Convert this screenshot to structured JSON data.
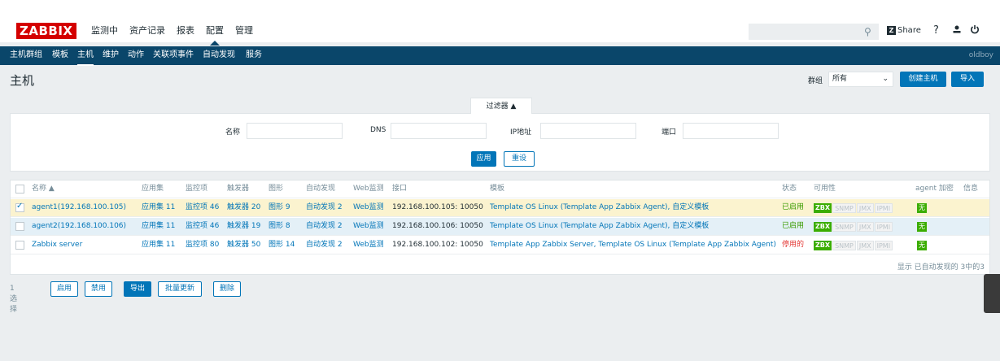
{
  "logo": "ZABBIX",
  "main_menu": [
    "监测中",
    "资产记录",
    "报表",
    "配置",
    "管理"
  ],
  "main_menu_selected": "配置",
  "share": "Share",
  "help": "?",
  "sub_menu": [
    "主机群组",
    "模板",
    "主机",
    "维护",
    "动作",
    "关联项事件",
    "自动发现",
    "服务"
  ],
  "sub_menu_selected": "主机",
  "user": "oldboy",
  "page_title": "主机",
  "group_filter": {
    "label": "群组",
    "value": "所有"
  },
  "create_button": "创建主机",
  "import_button": "导入",
  "filter": {
    "tab": "过滤器 ▲",
    "name_label": "名称",
    "dns_label": "DNS",
    "ip_label": "IP地址",
    "port_label": "端口",
    "apply": "应用",
    "reset": "重设"
  },
  "table": {
    "headers": [
      "名称 ▲",
      "应用集",
      "监控项",
      "触发器",
      "图形",
      "自动发现",
      "Web监测",
      "接口",
      "模板",
      "状态",
      "可用性",
      "agent 加密",
      "信息"
    ],
    "rows": [
      {
        "name": "agent1(192.168.100.105)",
        "apps": "应用集 11",
        "items": "监控项 46",
        "triggers": "触发器 20",
        "graphs": "图形 9",
        "discovery": "自动发现 2",
        "web": "Web监测",
        "interface": "192.168.100.105: 10050",
        "templates": "Template OS Linux (Template App Zabbix Agent), 自定义模板",
        "status": "已启用",
        "checked": true
      },
      {
        "name": "agent2(192.168.100.106)",
        "apps": "应用集 11",
        "items": "监控项 46",
        "triggers": "触发器 19",
        "graphs": "图形 8",
        "discovery": "自动发现 2",
        "web": "Web监测",
        "interface": "192.168.100.106: 10050",
        "templates": "Template OS Linux (Template App Zabbix Agent), 自定义模板",
        "status": "已启用",
        "checked": false
      },
      {
        "name": "Zabbix server",
        "apps": "应用集 11",
        "items": "监控项 80",
        "triggers": "触发器 50",
        "graphs": "图形 14",
        "discovery": "自动发现 2",
        "web": "Web监测",
        "interface": "192.168.100.102: 10050",
        "templates": "Template App Zabbix Server, Template OS Linux (Template App Zabbix Agent)",
        "status": "停用的",
        "checked": false
      }
    ],
    "availability": [
      "ZBX",
      "SNMP",
      "JMX",
      "IPMI"
    ],
    "encryption": "无",
    "footer": "显示 已自动发现的 3中的3"
  },
  "mass_actions": {
    "selected": "1 选择",
    "enable": "启用",
    "disable": "禁用",
    "export": "导出",
    "mass_update": "批量更新",
    "delete": "删除"
  },
  "colors": {
    "brand": "#d40000",
    "nav": "#0a466a",
    "accent": "#0275b8",
    "enabled": "#3a9b00",
    "disabled": "#e33734"
  }
}
